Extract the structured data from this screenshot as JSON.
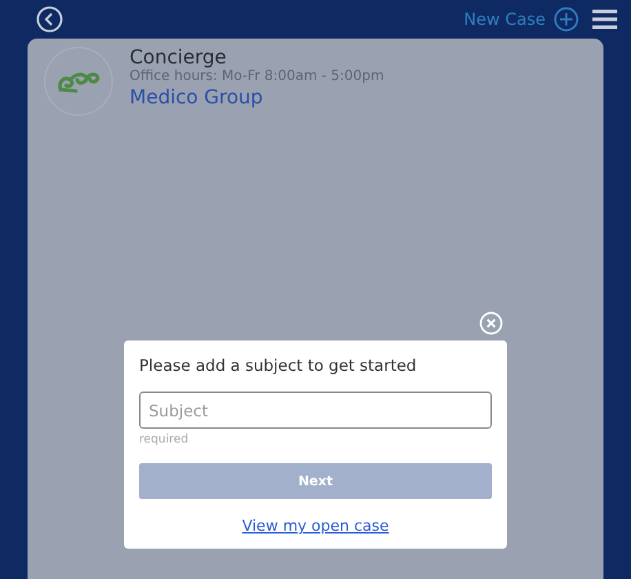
{
  "header": {
    "new_case_label": "New Case"
  },
  "concierge": {
    "title": "Concierge",
    "hours": "Office hours: Mo-Fr 8:00am - 5:00pm",
    "group": "Medico Group"
  },
  "dialog": {
    "prompt": "Please add a subject to get started",
    "subject": {
      "placeholder": "Subject"
    },
    "hint": "required",
    "next": {
      "label": "Next",
      "disabled": true
    },
    "link": "View my open case"
  }
}
